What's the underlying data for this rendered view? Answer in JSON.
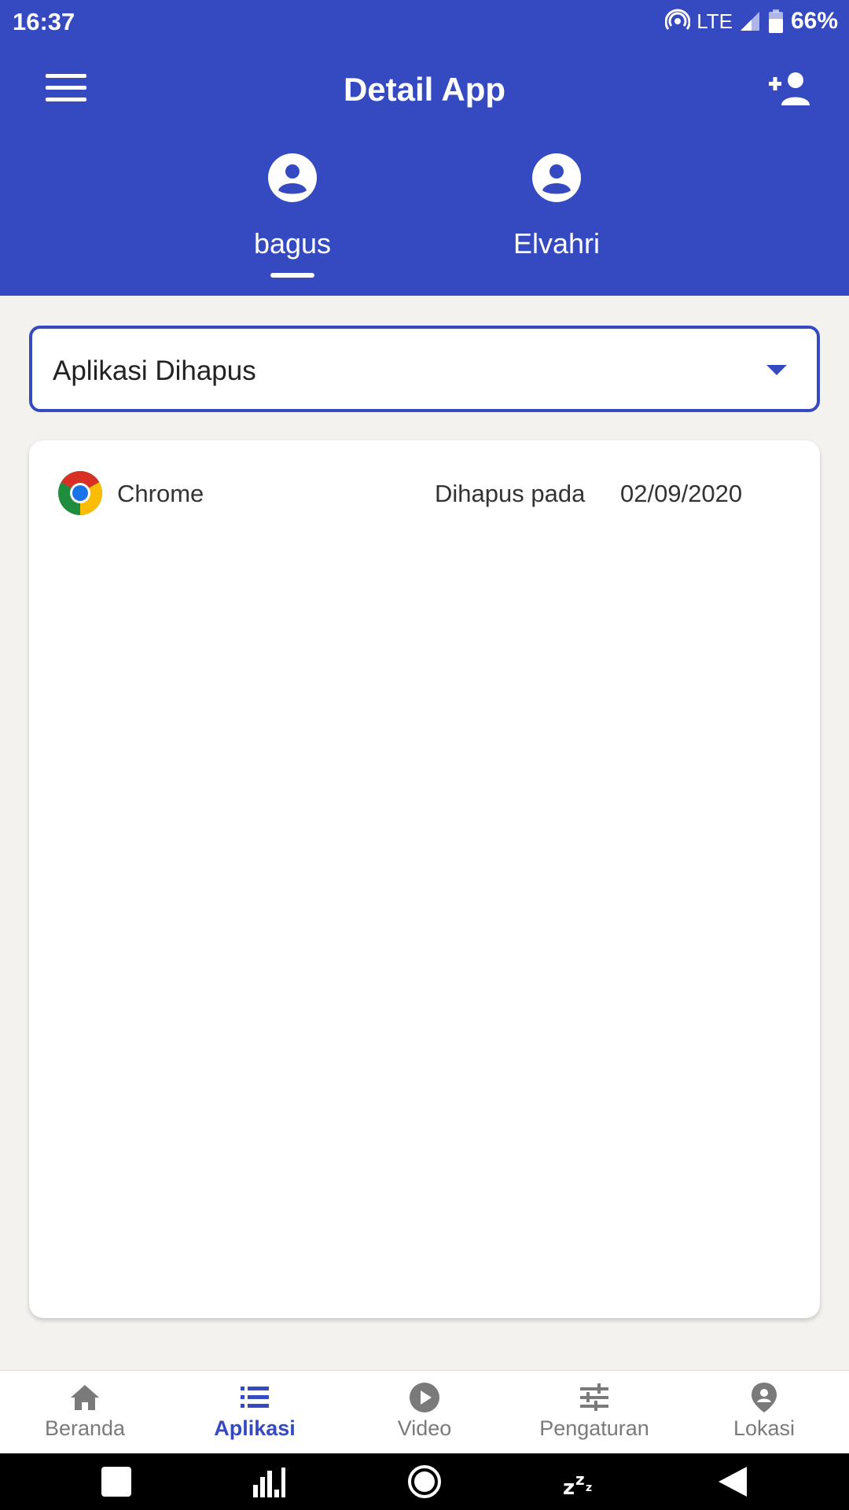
{
  "status_bar": {
    "time": "16:37",
    "network": "LTE",
    "battery": "66%"
  },
  "app_bar": {
    "title": "Detail App",
    "menu_icon": "hamburger-menu-icon",
    "add_user_icon": "person-add-icon"
  },
  "profiles": [
    {
      "name": "bagus",
      "selected": true
    },
    {
      "name": "Elvahri",
      "selected": false
    }
  ],
  "filter": {
    "selected": "Aplikasi Dihapus"
  },
  "deleted_apps": [
    {
      "name": "Chrome",
      "label": "Dihapus pada",
      "date": "02/09/2020",
      "icon": "chrome-icon"
    }
  ],
  "bottom_nav": {
    "items": [
      {
        "label": "Beranda",
        "icon": "home-icon"
      },
      {
        "label": "Aplikasi",
        "icon": "list-icon",
        "active": true
      },
      {
        "label": "Video",
        "icon": "play-circle-icon"
      },
      {
        "label": "Pengaturan",
        "icon": "sliders-icon"
      },
      {
        "label": "Lokasi",
        "icon": "location-pin-icon"
      }
    ]
  },
  "colors": {
    "primary": "#3549c1",
    "background": "#f3f2ef",
    "inactive": "#7a7a7a"
  }
}
